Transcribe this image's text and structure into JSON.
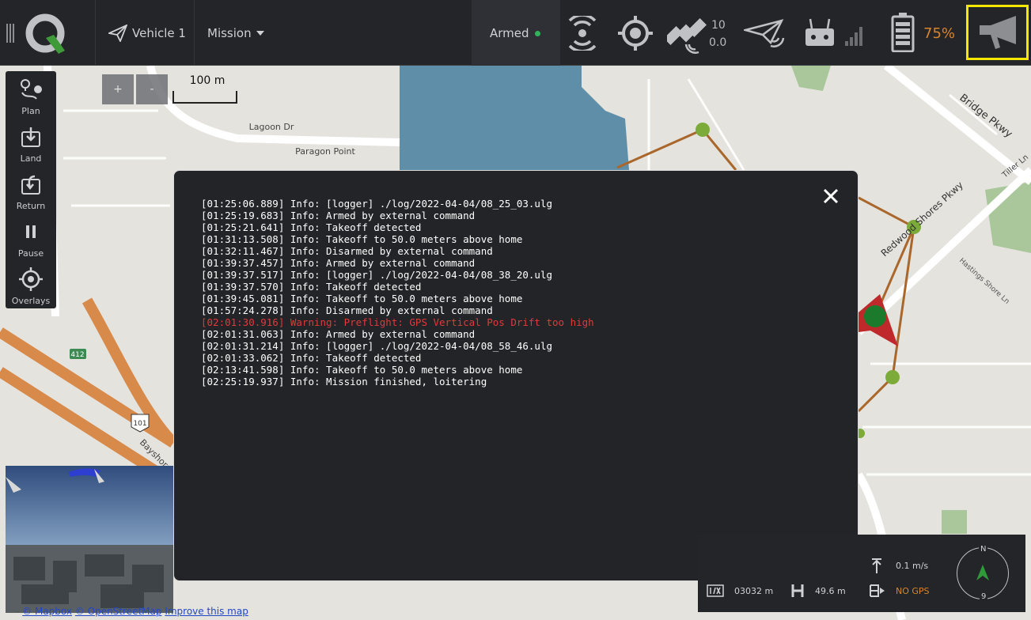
{
  "toolbar": {
    "vehicle_label": "Vehicle 1",
    "mode_label": "Mission",
    "status_label": "Armed",
    "status_color": "#2fb45a",
    "gps_sat_count": "10",
    "gps_hdop": "0.0",
    "battery_percent": "75%",
    "battery_color": "#d9842c",
    "icons": [
      "menu-icon",
      "app-logo",
      "plane-icon",
      "dropdown-icon",
      "signal-icon",
      "target-icon",
      "satellite-icon",
      "telemetry-icon",
      "rc-icon",
      "battery-icon",
      "megaphone-icon"
    ]
  },
  "tools": [
    {
      "label": "Plan",
      "icon": "plan-icon"
    },
    {
      "label": "Land",
      "icon": "land-icon"
    },
    {
      "label": "Return",
      "icon": "return-icon"
    },
    {
      "label": "Pause",
      "icon": "pause-icon"
    },
    {
      "label": "Overlays",
      "icon": "overlays-icon"
    }
  ],
  "map": {
    "zoom_in": "+",
    "zoom_out": "-",
    "scale_label": "100 m",
    "labels": [
      "Lagoon Dr",
      "Paragon Point",
      "Bridge Pkwy",
      "Redwood Shores Pkwy",
      "Hastings Shore Ln",
      "Tiller Ln",
      "Bayshore",
      "412",
      "101"
    ],
    "attribution": {
      "mapbox": "© Mapbox",
      "osm": "© OpenStreetMap",
      "improve": "Improve this map"
    }
  },
  "log": {
    "lines": [
      {
        "text": "[01:25:06.889] Info: [logger] ./log/2022-04-04/08_25_03.ulg",
        "level": "info"
      },
      {
        "text": "[01:25:19.683] Info: Armed by external command",
        "level": "info"
      },
      {
        "text": "[01:25:21.641] Info: Takeoff detected",
        "level": "info"
      },
      {
        "text": "[01:31:13.508] Info: Takeoff to 50.0 meters above home",
        "level": "info"
      },
      {
        "text": "[01:32:11.467] Info: Disarmed by external command",
        "level": "info"
      },
      {
        "text": "[01:39:37.457] Info: Armed by external command",
        "level": "info"
      },
      {
        "text": "[01:39:37.517] Info: [logger] ./log/2022-04-04/08_38_20.ulg",
        "level": "info"
      },
      {
        "text": "[01:39:37.570] Info: Takeoff detected",
        "level": "info"
      },
      {
        "text": "[01:39:45.081] Info: Takeoff to 50.0 meters above home",
        "level": "info"
      },
      {
        "text": "[01:57:24.278] Info: Disarmed by external command",
        "level": "info"
      },
      {
        "text": "[02:01:30.916] Warning: Preflight: GPS Vertical Pos Drift too high",
        "level": "warning"
      },
      {
        "text": "[02:01:31.063] Info: Armed by external command",
        "level": "info"
      },
      {
        "text": "[02:01:31.214] Info: [logger] ./log/2022-04-04/08_58_46.ulg",
        "level": "info"
      },
      {
        "text": "[02:01:33.062] Info: Takeoff detected",
        "level": "info"
      },
      {
        "text": "[02:13:41.598] Info: Takeoff to 50.0 meters above home",
        "level": "info"
      },
      {
        "text": "[02:25:19.937] Info: Mission finished, loitering",
        "level": "info"
      }
    ]
  },
  "telemetry": {
    "vertical_speed": "0.1 m/s",
    "distance": "03032 m",
    "altitude": "49.6 m",
    "gps_status": "NO GPS",
    "gps_status_color": "#d9842c",
    "compass_n": "N",
    "compass_heading": "9"
  }
}
